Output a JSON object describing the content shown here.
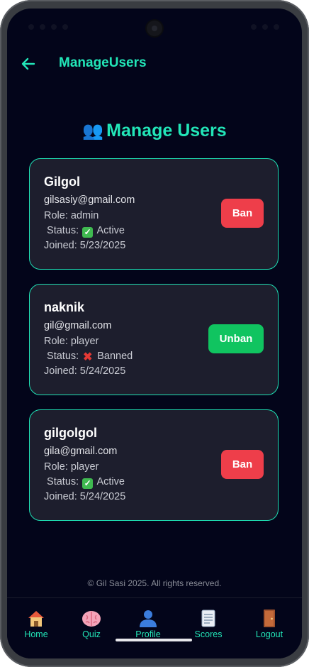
{
  "appbar": {
    "title": "ManageUsers"
  },
  "heading": {
    "emoji": "👥",
    "text": "Manage Users"
  },
  "users": [
    {
      "name": "Gilgol",
      "email": "gilsasiy@gmail.com",
      "role": "Role: admin",
      "status_prefix": " Status:",
      "status": "Active",
      "status_icon": "check-icon",
      "joined": "Joined: 5/23/2025",
      "action": "Ban"
    },
    {
      "name": "naknik",
      "email": "gil@gmail.com",
      "role": "Role: player",
      "status_prefix": " Status:",
      "status": "Banned",
      "status_icon": "cross-icon",
      "joined": "Joined: 5/24/2025",
      "action": "Unban"
    },
    {
      "name": "gilgolgol",
      "email": "gila@gmail.com",
      "role": "Role: player",
      "status_prefix": " Status:",
      "status": "Active",
      "status_icon": "check-icon",
      "joined": "Joined: 5/24/2025",
      "action": "Ban"
    }
  ],
  "footer": "© Gil Sasi 2025. All rights reserved.",
  "nav": [
    {
      "label": "Home",
      "icon": "house-icon"
    },
    {
      "label": "Quiz",
      "icon": "brain-icon"
    },
    {
      "label": "Profile",
      "icon": "person-icon"
    },
    {
      "label": "Scores",
      "icon": "scroll-icon"
    },
    {
      "label": "Logout",
      "icon": "door-icon"
    }
  ],
  "colors": {
    "accent": "#22e6b8",
    "background": "#03051a",
    "card": "#1d1e2d",
    "ban": "#ee3e4a",
    "unban": "#10c460"
  }
}
